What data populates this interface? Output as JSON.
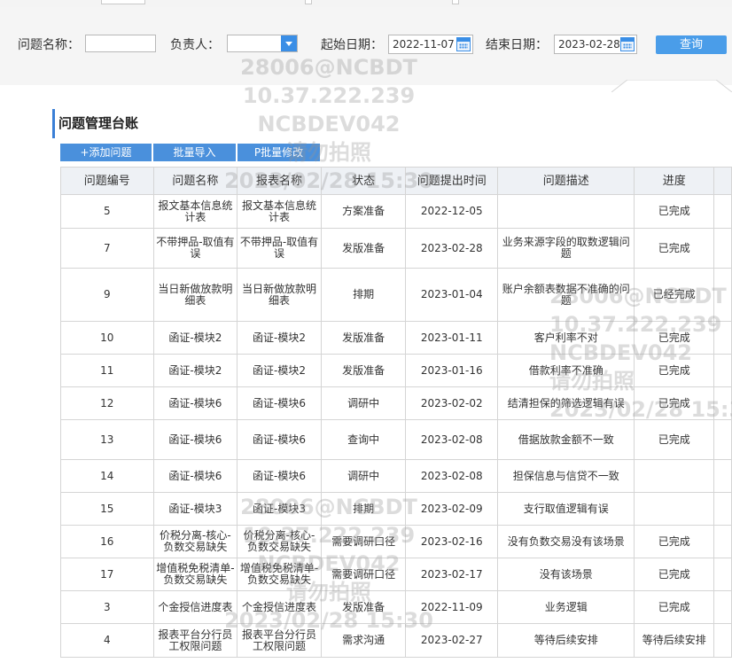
{
  "filters": {
    "issue_name_label": "问题名称：",
    "issue_name_value": "",
    "owner_label": "负责人：",
    "owner_value": "",
    "start_date_label": "起始日期：",
    "start_date_value": "2022-11-07",
    "end_date_label": "结束日期：",
    "end_date_value": "2023-02-28",
    "query_label": "查询"
  },
  "section_title": "问题管理台账",
  "toolbar": {
    "add": "+添加问题",
    "import": "批量导入",
    "modify": "P批量修改"
  },
  "table": {
    "headers": [
      "问题编号",
      "问题名称",
      "报表名称",
      "状态",
      "问题提出时间",
      "问题描述",
      "进度"
    ],
    "rows": [
      [
        "5",
        "报文基本信息统计表",
        "报文基本信息统计表",
        "方案准备",
        "2022-12-05",
        "",
        "已完成"
      ],
      [
        "7",
        "不带押品-取值有误",
        "不带押品-取值有误",
        "发版准备",
        "2023-02-28",
        "业务来源字段的取数逻辑问题",
        "已完成"
      ],
      [
        "9",
        "当日新做放款明细表",
        "当日新做放款明细表",
        "排期",
        "2023-01-04",
        "账户余额表数据不准确的问题",
        "已经完成"
      ],
      [
        "10",
        "函证-模块2",
        "函证-模块2",
        "发版准备",
        "2023-01-11",
        "客户利率不对",
        "已完成"
      ],
      [
        "11",
        "函证-模块2",
        "函证-模块2",
        "发版准备",
        "2023-01-16",
        "借款利率不准确",
        "已完成"
      ],
      [
        "12",
        "函证-模块6",
        "函证-模块6",
        "调研中",
        "2023-02-02",
        "结清担保的筛选逻辑有误",
        "已完成"
      ],
      [
        "13",
        "函证-模块6",
        "函证-模块6",
        "查询中",
        "2023-02-08",
        "借据放款金额不一致",
        "已完成"
      ],
      [
        "14",
        "函证-模块6",
        "函证-模块6",
        "调研中",
        "2023-02-08",
        "担保信息与信贷不一致",
        ""
      ],
      [
        "15",
        "函证-模块3",
        "函证-模块3",
        "排期",
        "2023-02-09",
        "支行取值逻辑有误",
        ""
      ],
      [
        "16",
        "价税分离-核心-负数交易缺失",
        "价税分离-核心-负数交易缺失",
        "需要调研口径",
        "2023-02-16",
        "没有负数交易没有该场景",
        "已完成"
      ],
      [
        "17",
        "增值税免税清单-负数交易缺失",
        "增值税免税清单-负数交易缺失",
        "需要调研口径",
        "2023-02-17",
        "没有该场景",
        "已完成"
      ],
      [
        "3",
        "个金授信进度表",
        "个金授信进度表",
        "发版准备",
        "2022-11-09",
        "业务逻辑",
        "已完成"
      ],
      [
        "4",
        "报表平台分行员工权限问题",
        "报表平台分行员工权限问题",
        "需求沟通",
        "2023-02-27",
        "等待后续安排",
        "等待后续安排"
      ]
    ]
  },
  "watermark": {
    "line1": "28006@NCBDT",
    "line2": "10.37.222.239",
    "line3": "NCBDEV042",
    "line4": "请勿拍照",
    "line5": "2023/02/28 15:30"
  },
  "icons": {
    "calendar": "calendar-icon",
    "dropdown": "chevron-down-icon"
  },
  "colors": {
    "accent": "#4a90dc",
    "header_bg": "#eef1f5",
    "filter_bg": "#f5f5f5"
  }
}
